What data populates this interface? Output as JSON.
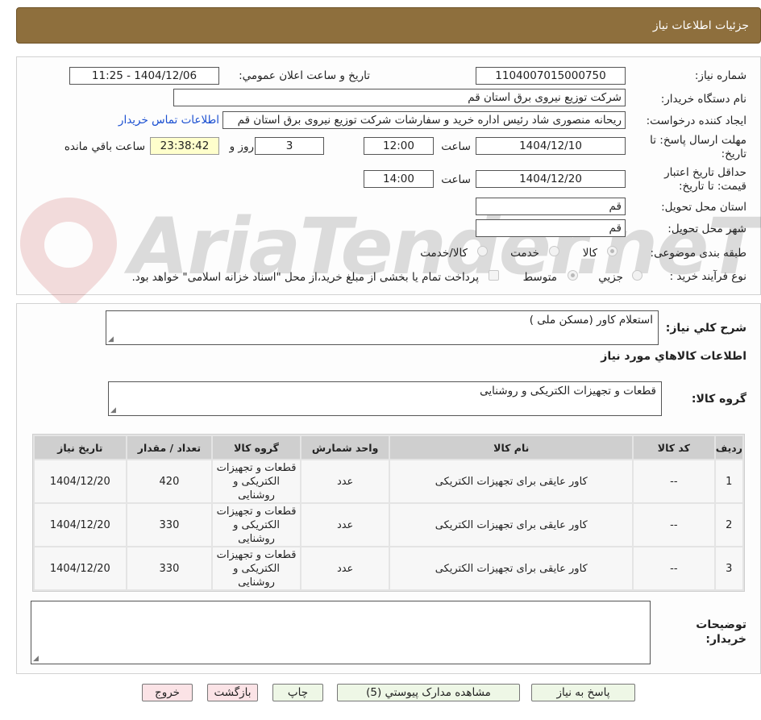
{
  "header": {
    "title": "جزئیات اطلاعات نیاز"
  },
  "need": {
    "number_label": "شماره نیاز:",
    "number_value": "1104007015000750",
    "announce_label": "تاریخ و ساعت اعلان عمومي:",
    "announce_value": "1404/12/06 - 11:25",
    "buyer_label": "نام دستگاه خريدار:",
    "buyer_value": "شرکت توزیع نیروی برق استان قم",
    "creator_label": "ايجاد کننده درخواست:",
    "creator_value": "ریحانه منصوری شاد رئیس اداره خرید و سفارشات شرکت توزیع نیروی برق استان قم",
    "contact_link": "اطلاعات تماس خریدار",
    "deadline_label_1": "مهلت ارسال پاسخ: تا",
    "deadline_label_2": "تاريخ:",
    "deadline_date": "1404/12/10",
    "time_label": "ساعت",
    "deadline_time": "12:00",
    "days_value": "3",
    "days_label": "روز و",
    "remaining_time": "23:38:42",
    "remaining_label": "ساعت باقي مانده",
    "validity_label_1": "حداقل تاريخ اعتبار",
    "validity_label_2": "قيمت: تا تاريخ:",
    "validity_date": "1404/12/20",
    "validity_time": "14:00",
    "province_label": "استان محل تحويل:",
    "province_value": "قم",
    "city_label": "شهر محل تحويل:",
    "city_value": "قم",
    "category_label": "طبقه بندی موضوعی:",
    "category_options": [
      "کالا",
      "خدمت",
      "کالا/خدمت"
    ],
    "process_label": "نوع فرآيند خريد :",
    "process_options": [
      "جزيي",
      "متوسط"
    ],
    "payment_note": "پرداخت تمام یا بخشی از مبلغ خرید،از محل \"اسناد خزانه اسلامی\" خواهد بود."
  },
  "summary": {
    "label": "شرح کلي نياز:",
    "value": "استعلام کاور (مسکن ملی )",
    "goods_title": "اطلاعات کالاهاي مورد نياز",
    "group_label": "گروه کالا:",
    "group_value": "قطعات و تجهیزات الکتریکی و روشنایی"
  },
  "table": {
    "headers": [
      "رديف",
      "کد کالا",
      "نام کالا",
      "واحد شمارش",
      "گروه کالا",
      "تعداد / مقدار",
      "تاريخ نياز"
    ],
    "rows": [
      {
        "row": "1",
        "code": "--",
        "name": "کاور عایقی برای تجهیزات الکتریکی",
        "unit": "عدد",
        "group": "قطعات و تجهیزات الکتریکی و روشنایی",
        "qty": "420",
        "date": "1404/12/20"
      },
      {
        "row": "2",
        "code": "--",
        "name": "کاور عایقی برای تجهیزات الکتریکی",
        "unit": "عدد",
        "group": "قطعات و تجهیزات الکتریکی و روشنایی",
        "qty": "330",
        "date": "1404/12/20"
      },
      {
        "row": "3",
        "code": "--",
        "name": "کاور عایقی برای تجهیزات الکتریکی",
        "unit": "عدد",
        "group": "قطعات و تجهیزات الکتریکی و روشنایی",
        "qty": "330",
        "date": "1404/12/20"
      }
    ]
  },
  "notes": {
    "label_1": "توضيحات",
    "label_2": "خريدار:"
  },
  "buttons": {
    "reply": "پاسخ به نياز",
    "attachments": "مشاهده مدارک پيوستي (5)",
    "print": "چاپ",
    "back": "بازگشت",
    "exit": "خروج"
  },
  "watermark": {
    "text": "AriaTender.neT"
  },
  "colors": {
    "header_bg": "#8e6f3d",
    "link": "#1a4fd1",
    "remaining_bg": "#ffffcc",
    "button_green": "#eef7e6",
    "button_pink": "#fbe3e6"
  }
}
